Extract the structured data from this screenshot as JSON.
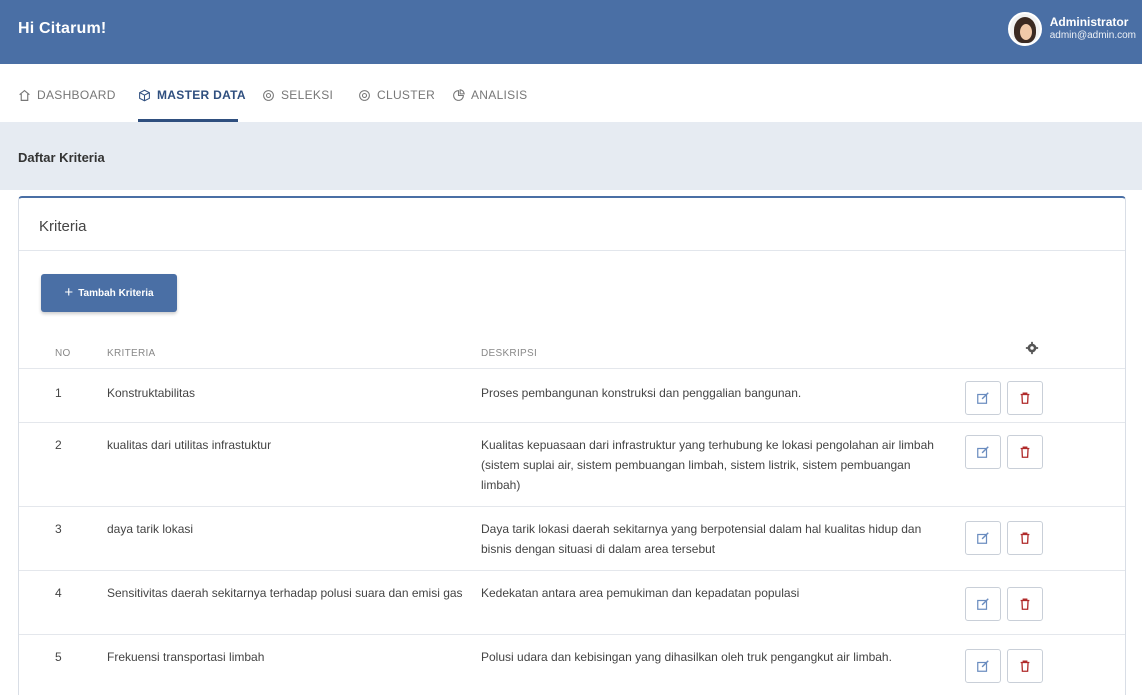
{
  "app": {
    "brand": "Hi Citarum!",
    "user_name": "Administrator",
    "user_email": "admin@admin.com"
  },
  "nav": {
    "items": [
      {
        "label": "DASHBOARD",
        "icon": "home-icon"
      },
      {
        "label": "MASTER DATA",
        "icon": "box-icon",
        "active": true
      },
      {
        "label": "SELEKSI",
        "icon": "target-icon"
      },
      {
        "label": "CLUSTER",
        "icon": "target-icon"
      },
      {
        "label": "ANALISIS",
        "icon": "pie-chart-icon"
      }
    ]
  },
  "page": {
    "title": "Daftar Kriteria"
  },
  "card": {
    "title": "Kriteria",
    "add_button": "Tambah Kriteria"
  },
  "table": {
    "headers": {
      "no": "NO",
      "kriteria": "KRITERIA",
      "deskripsi": "DESKRIPSI",
      "actions_icon": "gear-icon"
    },
    "rows": [
      {
        "no": "1",
        "kriteria": "Konstruktabilitas",
        "deskripsi": "Proses pembangunan konstruksi dan penggalian bangunan."
      },
      {
        "no": "2",
        "kriteria": "kualitas dari utilitas infrastuktur",
        "deskripsi": "Kualitas kepuasaan dari infrastruktur yang terhubung ke lokasi pengolahan air limbah (sistem suplai air, sistem pembuangan limbah, sistem listrik, sistem pembuangan limbah)"
      },
      {
        "no": "3",
        "kriteria": "daya tarik lokasi",
        "deskripsi": "Daya tarik lokasi daerah sekitarnya yang berpotensial dalam hal kualitas hidup dan bisnis dengan situasi di dalam area tersebut"
      },
      {
        "no": "4",
        "kriteria": "Sensitivitas daerah sekitarnya terhadap polusi suara dan emisi gas",
        "deskripsi": "Kedekatan antara area pemukiman dan kepadatan populasi"
      },
      {
        "no": "5",
        "kriteria": "Frekuensi transportasi limbah",
        "deskripsi": "Polusi udara dan kebisingan yang dihasilkan oleh truk pengangkut air limbah."
      }
    ]
  },
  "colors": {
    "primary": "#4a6fa5",
    "header_bg": "#e6ebf2",
    "edit_icon": "#6a8cbf",
    "delete_icon": "#b02a2a"
  }
}
